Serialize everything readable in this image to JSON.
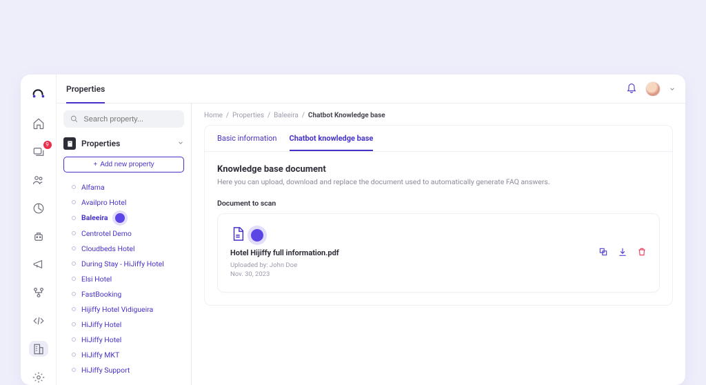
{
  "topbar": {
    "title": "Properties"
  },
  "rail": {
    "badge": "9"
  },
  "search": {
    "placeholder": "Search property..."
  },
  "panel": {
    "heading": "Properties",
    "add_label": "Add new property"
  },
  "properties": [
    "Alfama",
    "Availpro Hotel",
    "Baleeira",
    "Centrotel Demo",
    "Cloudbeds Hotel",
    "During Stay - HiJiffy Hotel",
    "Elsi Hotel",
    "FastBooking",
    "Hijiffy Hotel Vidigueira",
    "HiJiffy Hotel",
    "HiJiffy Hotel",
    "HiJiffy MKT",
    "HiJiffy Support"
  ],
  "selected_index": 2,
  "breadcrumbs": {
    "home": "Home",
    "sep": "/",
    "l1": "Properties",
    "l2": "Baleeira",
    "current": "Chatbot Knowledge base"
  },
  "tabs": {
    "basic": "Basic information",
    "kb": "Chatbot knowledge base"
  },
  "kb": {
    "title": "Knowledge base document",
    "subtitle": "Here you can upload, download and replace the document used to automatically generate FAQ answers.",
    "section_label": "Document to scan",
    "doc": {
      "name": "Hotel Hijiffy full information.pdf",
      "uploader": "Uploaded by: John Doe",
      "date": "Nov. 30, 2023"
    }
  }
}
